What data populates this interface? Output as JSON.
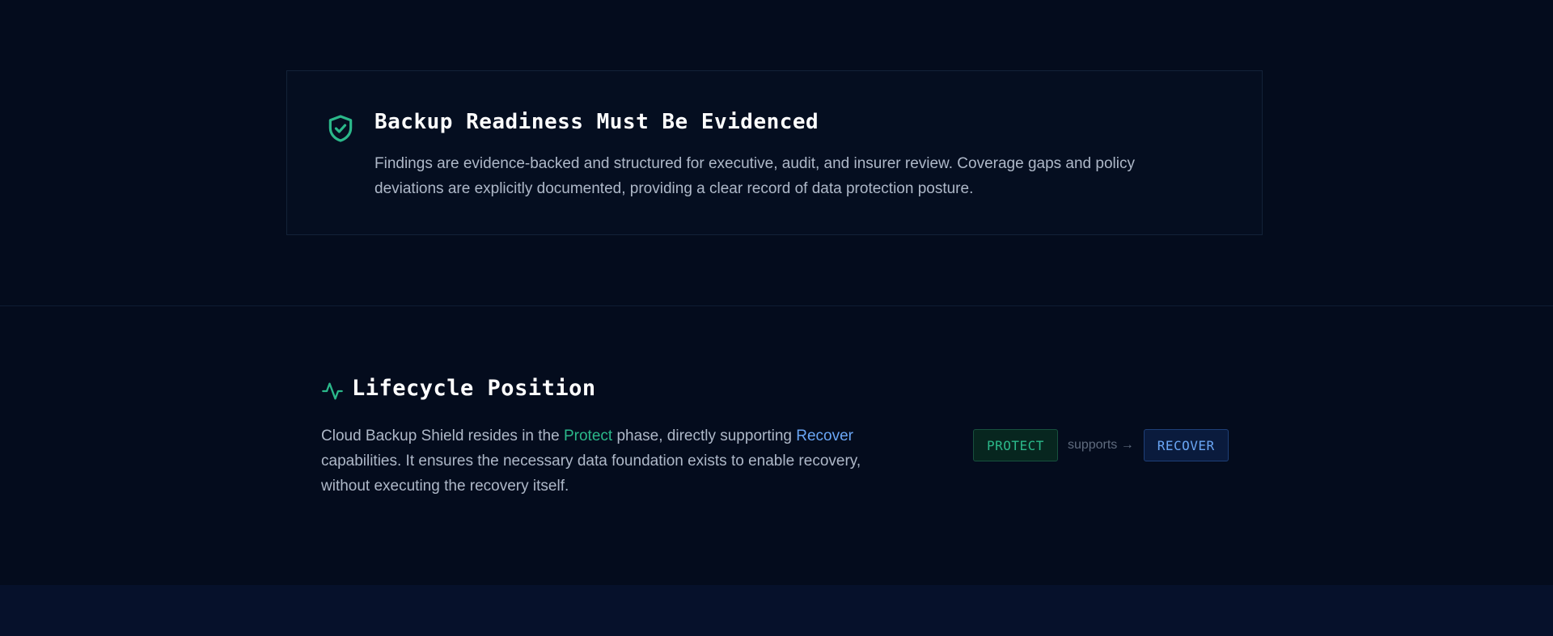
{
  "evidence": {
    "icon": "shield-check-icon",
    "title": "Backup Readiness Must Be Evidenced",
    "body": "Findings are evidence-backed and structured for executive, audit, and insurer review. Coverage gaps and policy deviations are explicitly documented, providing a clear record of data protection posture."
  },
  "lifecycle": {
    "icon": "activity-pulse-icon",
    "title": "Lifecycle Position",
    "body_part1": "Cloud Backup Shield resides in the ",
    "highlight_protect": "Protect",
    "body_part2": " phase, directly supporting ",
    "highlight_recover": "Recover",
    "body_part3": " capabilities. It ensures the necessary data foundation exists to enable recovery, without executing the recovery itself.",
    "flow": {
      "from_label": "PROTECT",
      "connector": "supports →",
      "to_label": "RECOVER"
    }
  },
  "colors": {
    "accent_green": "#2bb88a",
    "accent_blue": "#6aa6f5",
    "background": "#040c1d"
  }
}
